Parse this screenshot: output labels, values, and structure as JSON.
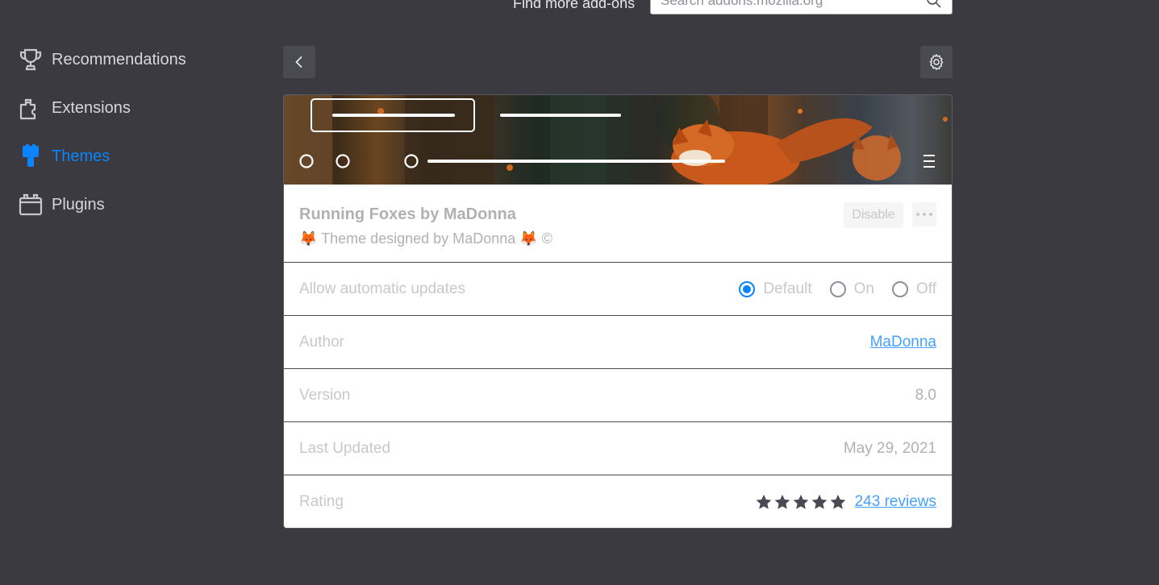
{
  "topbar": {
    "find_more_label": "Find more add-ons",
    "search_placeholder": "Search addons.mozilla.org"
  },
  "sidebar": {
    "items": [
      {
        "label": "Recommendations",
        "icon": "trophy-icon",
        "active": false
      },
      {
        "label": "Extensions",
        "icon": "puzzle-icon",
        "active": false
      },
      {
        "label": "Themes",
        "icon": "brush-icon",
        "active": true
      },
      {
        "label": "Plugins",
        "icon": "plugin-icon",
        "active": false
      }
    ]
  },
  "toolbar": {
    "back_icon": "chevron-left-icon",
    "settings_icon": "gear-icon"
  },
  "addon": {
    "name": "Running Foxes by MaDonna",
    "description": "🦊 Theme designed by MaDonna 🦊 ©",
    "disable_label": "Disable",
    "more_icon": "more-options-icon"
  },
  "details": {
    "updates": {
      "label": "Allow automatic updates",
      "options": [
        "Default",
        "On",
        "Off"
      ],
      "selected": "Default"
    },
    "author": {
      "label": "Author",
      "value": "MaDonna"
    },
    "version": {
      "label": "Version",
      "value": "8.0"
    },
    "last_updated": {
      "label": "Last Updated",
      "value": "May 29, 2021"
    },
    "rating": {
      "label": "Rating",
      "stars": 5,
      "reviews_label": "243 reviews"
    }
  },
  "colors": {
    "accent": "#0a84ff",
    "background": "#3b3a41",
    "link": "#45a1ff"
  }
}
